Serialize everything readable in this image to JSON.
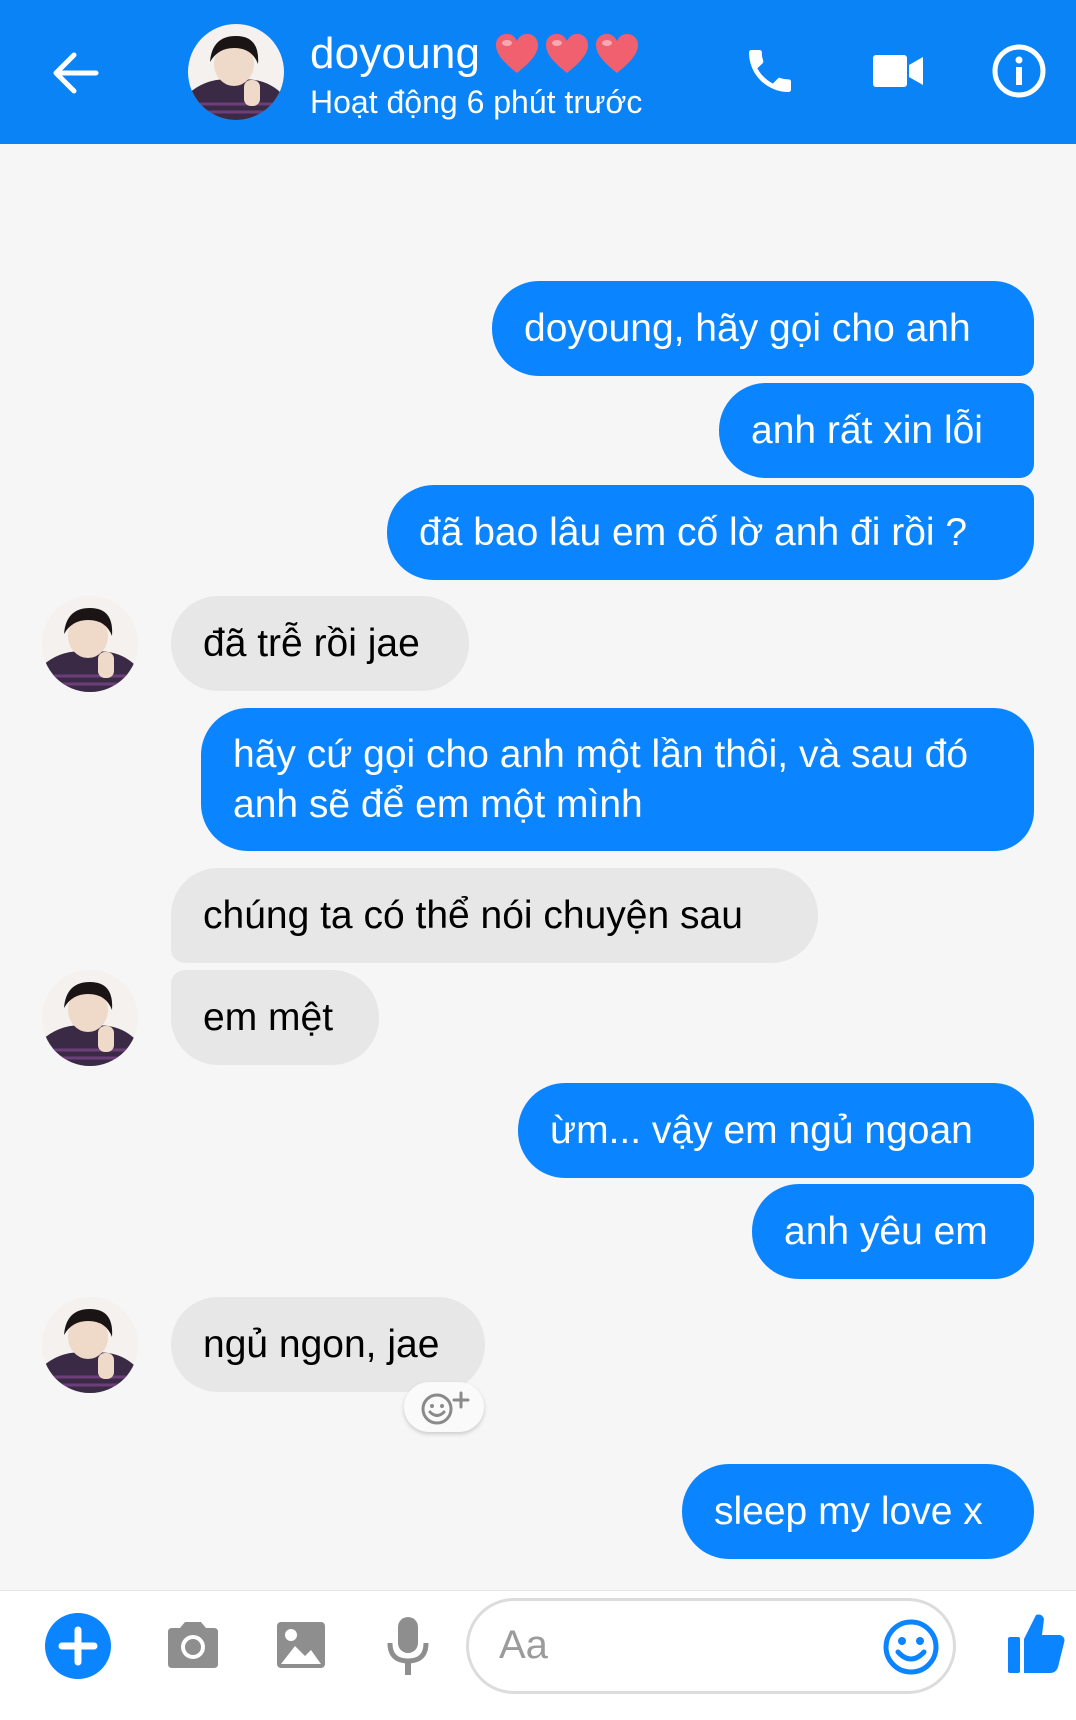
{
  "header": {
    "contact_name": "doyoung",
    "status": "Hoạt động 6 phút trước",
    "bg_color": "#0a83f6"
  },
  "icons": {
    "back": "arrow-left-icon",
    "call": "phone-icon",
    "video": "video-camera-icon",
    "info": "info-icon",
    "add": "plus-icon",
    "camera": "camera-icon",
    "gallery": "image-icon",
    "mic": "microphone-icon",
    "emoji": "smiley-icon",
    "like": "thumbs-up-icon"
  },
  "messages": [
    {
      "from": "me",
      "text": "doyoung, hãy gọi cho anh"
    },
    {
      "from": "me",
      "text": "anh rất xin lỗi"
    },
    {
      "from": "me",
      "text": "đã bao lâu em cố lờ anh đi rồi ?"
    },
    {
      "from": "them",
      "text": "đã trễ rồi jae"
    },
    {
      "from": "me",
      "text": "hãy cứ gọi cho anh một lần thôi, và sau đó anh sẽ để em một mình"
    },
    {
      "from": "them",
      "text": "chúng ta có thể nói chuyện sau"
    },
    {
      "from": "them",
      "text": "em mệt"
    },
    {
      "from": "me",
      "text": "ừm... vậy em ngủ ngoan"
    },
    {
      "from": "me",
      "text": "anh yêu em"
    },
    {
      "from": "them",
      "text": "ngủ ngon, jae"
    },
    {
      "from": "me",
      "text": "sleep my love x"
    }
  ],
  "composer": {
    "placeholder": "Aa"
  },
  "colors": {
    "my_bubble": "#0a84ff",
    "their_bubble": "#e7e7e7",
    "heart": "#f0606f"
  }
}
